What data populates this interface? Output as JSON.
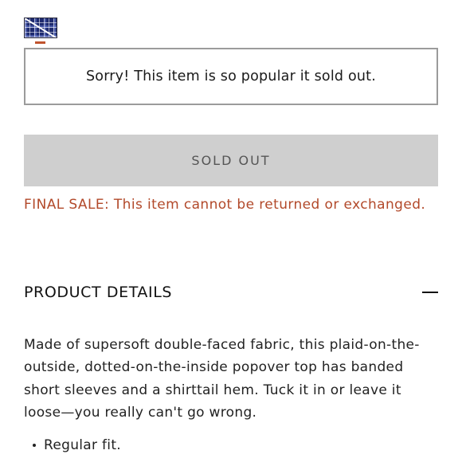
{
  "swatch": {
    "name": "plaid-swatch-icon",
    "color_primary": "#1e2a6e",
    "selected_indicator_color": "#c0542e",
    "state": "unavailable"
  },
  "sold_out_message": "Sorry! This item is so popular it sold out.",
  "sold_out_button_label": "SOLD OUT",
  "final_sale_notice": "FINAL SALE: This item cannot be returned or exchanged.",
  "product_details": {
    "title": "PRODUCT DETAILS",
    "toggle_icon": "minus-icon",
    "description": "Made of supersoft double-faced fabric, this plaid-on-the-outside, dotted-on-the-inside popover top has banded short sleeves and a shirttail hem. Tuck it in or leave it loose—you really can't go wrong.",
    "bullets": [
      "Regular fit."
    ]
  },
  "colors": {
    "accent": "#b2492a",
    "button_bg": "#cfcfcf",
    "button_text": "#555555",
    "border": "#9b9b9b"
  }
}
